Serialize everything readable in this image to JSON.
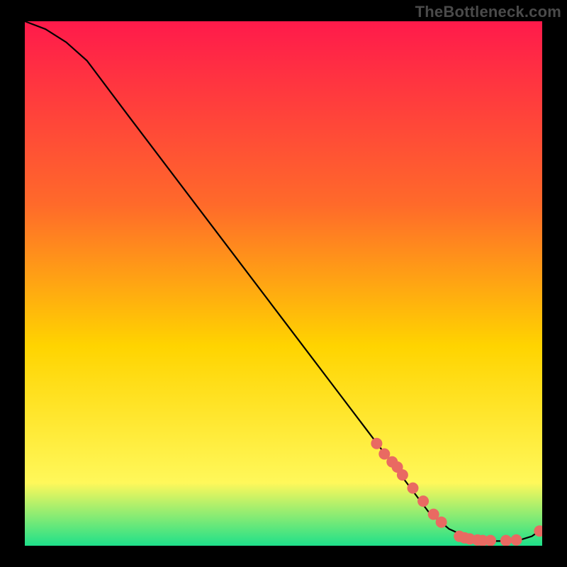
{
  "watermark": "TheBottleneck.com",
  "colors": {
    "gradient_top": "#ff1a4b",
    "gradient_mid1": "#ff6a2a",
    "gradient_mid2": "#ffd400",
    "gradient_mid3": "#fff85a",
    "gradient_bottom": "#1ee08a",
    "curve": "#000000",
    "marker_fill": "#e96a62",
    "marker_stroke": "#c94e47"
  },
  "chart_data": {
    "type": "line",
    "title": "",
    "xlabel": "",
    "ylabel": "",
    "xlim": [
      0,
      100
    ],
    "ylim": [
      0,
      100
    ],
    "series": [
      {
        "name": "bottleneck-curve",
        "x": [
          0,
          4,
          8,
          12,
          20,
          30,
          40,
          50,
          60,
          70,
          78,
          82,
          86,
          88,
          90,
          92,
          94,
          96,
          98,
          100
        ],
        "y": [
          100,
          98.5,
          96,
          92.5,
          82,
          69,
          56,
          43,
          30,
          17,
          6.5,
          3.2,
          1.4,
          1.0,
          0.9,
          0.9,
          1.0,
          1.2,
          1.8,
          3.2
        ]
      }
    ],
    "markers": {
      "name": "highlighted-points",
      "x": [
        68,
        69.5,
        71,
        72,
        73,
        75,
        77,
        79,
        80.5,
        84,
        85,
        86,
        87.5,
        88.5,
        90,
        93,
        95,
        99.5
      ],
      "y": [
        19.5,
        17.5,
        16,
        15,
        13.5,
        11,
        8.5,
        6,
        4.5,
        1.8,
        1.5,
        1.3,
        1.1,
        1.0,
        1.0,
        1.0,
        1.1,
        2.8
      ]
    }
  }
}
